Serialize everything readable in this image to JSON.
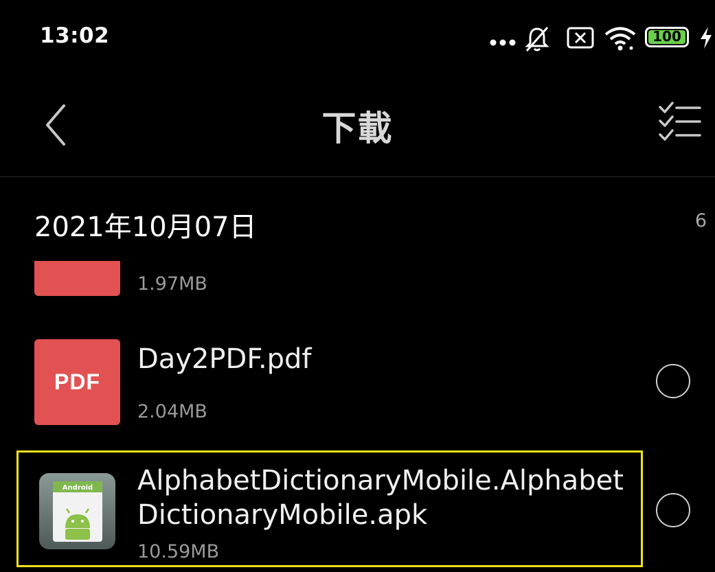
{
  "status_bar": {
    "time": "13:02",
    "battery": "100",
    "icons": [
      "more-dots-icon",
      "mute-icon",
      "no-sim-icon",
      "wifi-icon",
      "battery-icon",
      "charging-icon"
    ]
  },
  "header": {
    "title": "下載",
    "back_icon": "chevron-left-icon",
    "select_icon": "checklist-icon"
  },
  "group": {
    "date": "2021年10月07日",
    "count": "6"
  },
  "files": [
    {
      "name": "",
      "size": "1.97MB",
      "type": "pdf",
      "thumb_label": ""
    },
    {
      "name": "Day2PDF.pdf",
      "size": "2.04MB",
      "type": "pdf",
      "thumb_label": "PDF"
    },
    {
      "name": "AlphabetDictionaryMobile.Alphabet\nDictionaryMobile.apk",
      "size": "10.59MB",
      "type": "apk",
      "thumb_label": "Android"
    }
  ],
  "colors": {
    "background": "#000000",
    "pdf_thumb": "#e25252",
    "highlight": "#f2e21a",
    "battery_green": "#6ad04a"
  }
}
